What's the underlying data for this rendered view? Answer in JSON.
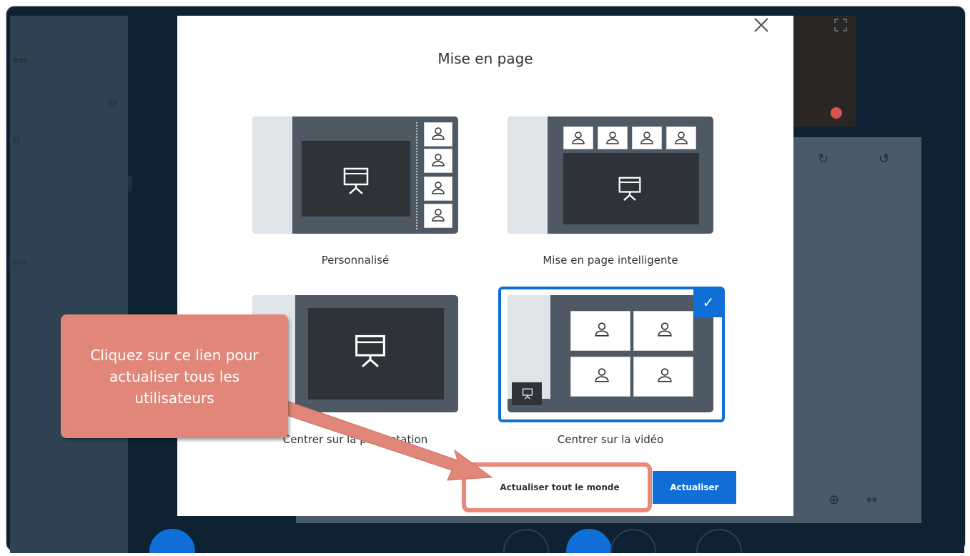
{
  "background_app": {
    "sidebar_items": [
      "ées",
      "sJ",
      "bile"
    ],
    "toolbar_icons": [
      "redo-icon",
      "undo-icon",
      "zoom-in-icon",
      "fit-width-icon"
    ]
  },
  "dialog": {
    "title": "Mise en page",
    "options": [
      {
        "label": "Personnalisé",
        "selected": false
      },
      {
        "label": "Mise en page intelligente",
        "selected": false
      },
      {
        "label": "Centrer sur la présentation",
        "selected": false
      },
      {
        "label": "Centrer sur la vidéo",
        "selected": true
      }
    ],
    "buttons": {
      "update_all": "Actualiser tout le monde",
      "update": "Actualiser"
    }
  },
  "callout": {
    "text": "Cliquez sur ce lien pour actualiser tous les utilisateurs",
    "color": "#e0877a"
  },
  "colors": {
    "accent": "#0f6fd6",
    "highlight": "#e8897a"
  }
}
